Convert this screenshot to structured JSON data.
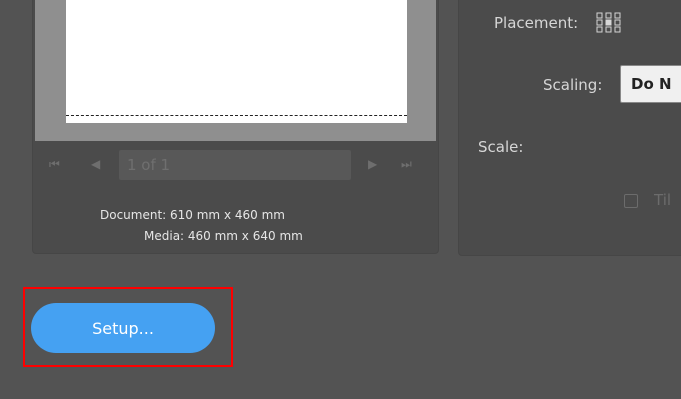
{
  "preview": {
    "page_indicator": "1 of 1",
    "document_size": "Document: 610 mm x 460 mm",
    "media_size": "Media: 460 mm x 640 mm"
  },
  "options": {
    "placement_label": "Placement:",
    "scaling_label": "Scaling:",
    "scaling_value": "Do N",
    "scale_label": "Scale:",
    "tile_label": "Til"
  },
  "actions": {
    "setup_label": "Setup..."
  },
  "colors": {
    "background": "#535353",
    "panel": "#4b4b4b",
    "accent_button": "#45a1f2",
    "highlight": "#ff0000"
  }
}
